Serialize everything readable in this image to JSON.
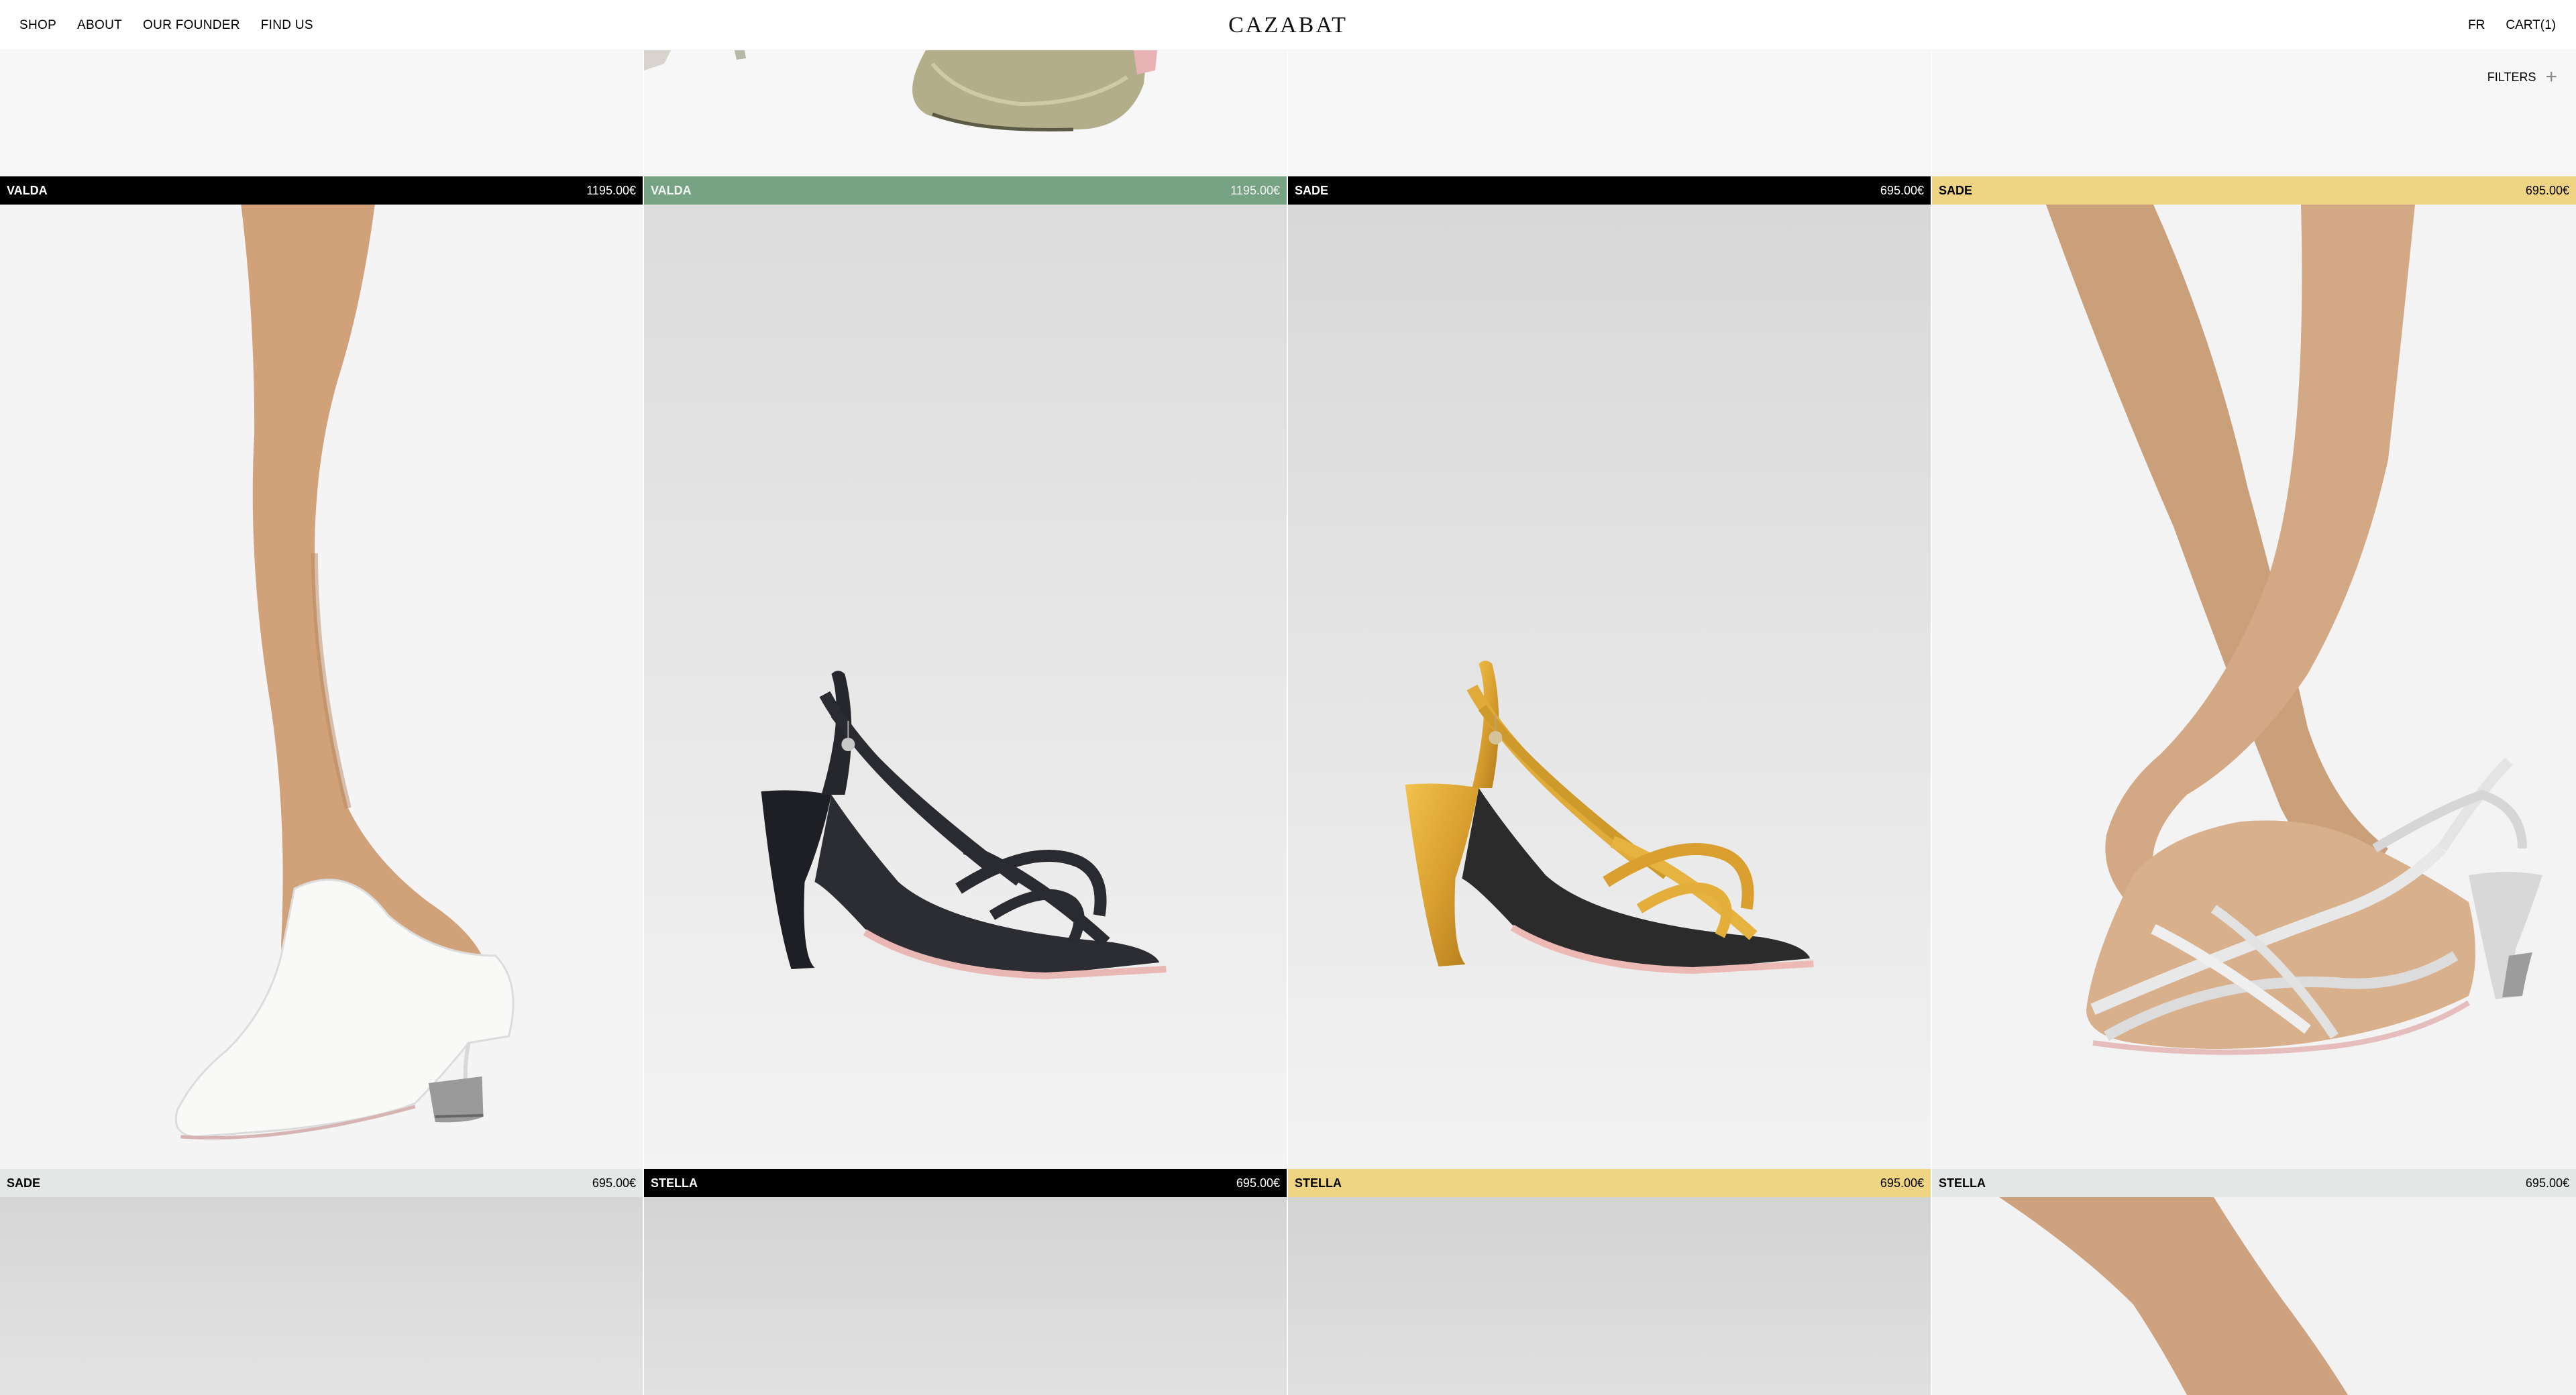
{
  "header": {
    "nav_left": [
      "SHOP",
      "ABOUT",
      "OUR FOUNDER",
      "FIND US"
    ],
    "logo": "CAZABAT",
    "language": "FR",
    "cart": "CART(1)"
  },
  "filters": {
    "label": "FILTERS",
    "icon": "plus-icon"
  },
  "colors": {
    "black": "#000000",
    "green": "#76a383",
    "yellow": "#efd583",
    "lightgray": "#e3e8e6"
  },
  "products_row1": [
    {
      "name": "VALDA",
      "price": "1195.00€",
      "bar": "black"
    },
    {
      "name": "VALDA",
      "price": "1195.00€",
      "bar": "green"
    },
    {
      "name": "SADE",
      "price": "695.00€",
      "bar": "black"
    },
    {
      "name": "SADE",
      "price": "695.00€",
      "bar": "yellow"
    }
  ],
  "products_row2": [
    {
      "name": "SADE",
      "price": "695.00€",
      "bar": "lightgray"
    },
    {
      "name": "STELLA",
      "price": "695.00€",
      "bar": "black"
    },
    {
      "name": "STELLA",
      "price": "695.00€",
      "bar": "yellow"
    },
    {
      "name": "STELLA",
      "price": "695.00€",
      "bar": "lightgray"
    }
  ]
}
